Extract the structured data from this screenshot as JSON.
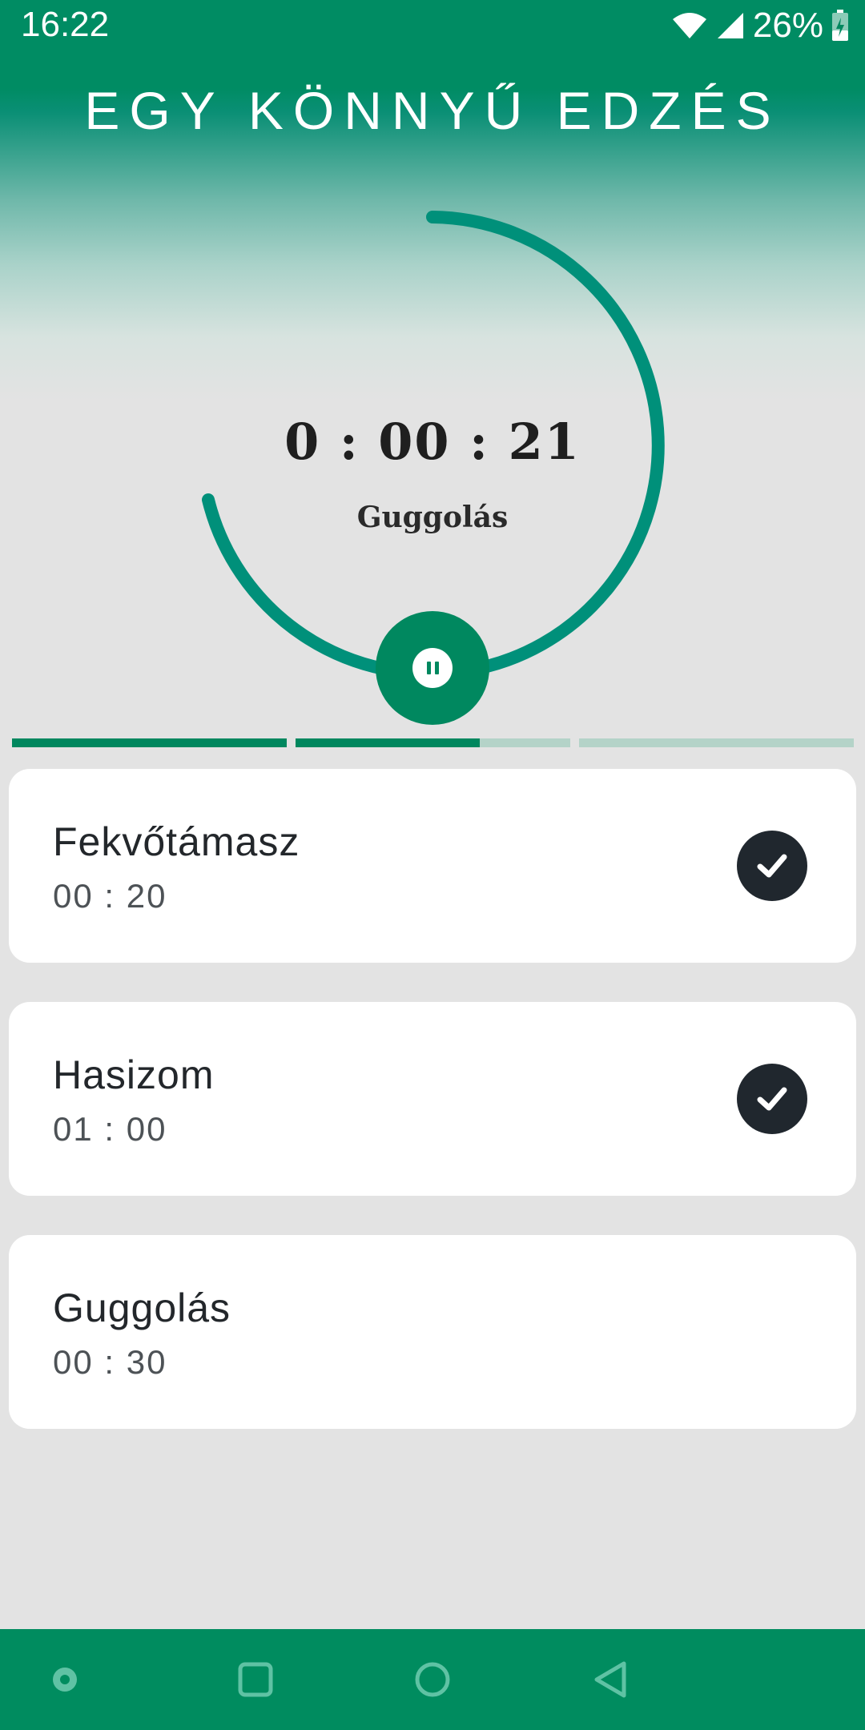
{
  "status_bar": {
    "time": "16:22",
    "battery": "26%"
  },
  "workout": {
    "title": "EGY KÖNNYŰ EDZÉS",
    "timer": "0 : 00 : 21",
    "current_exercise": "Guggolás",
    "segment_progress": [
      1.0,
      0.67,
      0.0
    ]
  },
  "exercises": [
    {
      "name": "Fekvőtámasz",
      "duration": "00 : 20",
      "done": true
    },
    {
      "name": "Hasizom",
      "duration": "01 : 00",
      "done": true
    },
    {
      "name": "Guggolás",
      "duration": "00 : 30",
      "done": false
    }
  ],
  "colors": {
    "accent": "#00885f",
    "ring": "#00907a",
    "check_bg": "#20272e",
    "card_bg": "#ffffff",
    "background": "#e3e3e3"
  },
  "icons": {
    "pause": "pause-icon",
    "check": "check-icon",
    "nav": [
      "dot-icon",
      "recents-icon",
      "home-icon",
      "back-icon"
    ]
  }
}
